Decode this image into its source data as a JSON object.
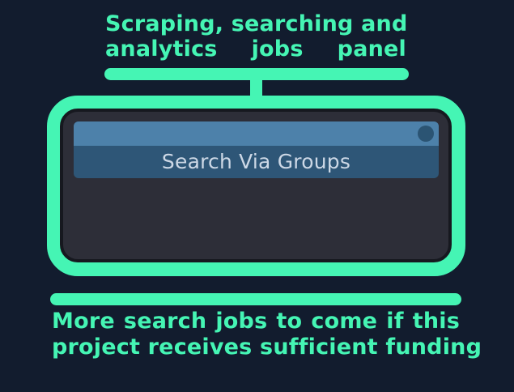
{
  "top_caption": {
    "line1": "Scraping, searching and",
    "line2": "analytics jobs panel"
  },
  "panel": {
    "job_label": "Search Via Groups"
  },
  "bottom_caption": {
    "line1": "More search jobs to come if this",
    "line2": "project receives sufficient funding"
  },
  "colors": {
    "background": "#121c2e",
    "accent": "#45f5b4",
    "panel_bg": "#2d2e38",
    "card_header": "#4d81aa",
    "card_body": "#2e5677",
    "card_text": "#cdd8e6"
  }
}
